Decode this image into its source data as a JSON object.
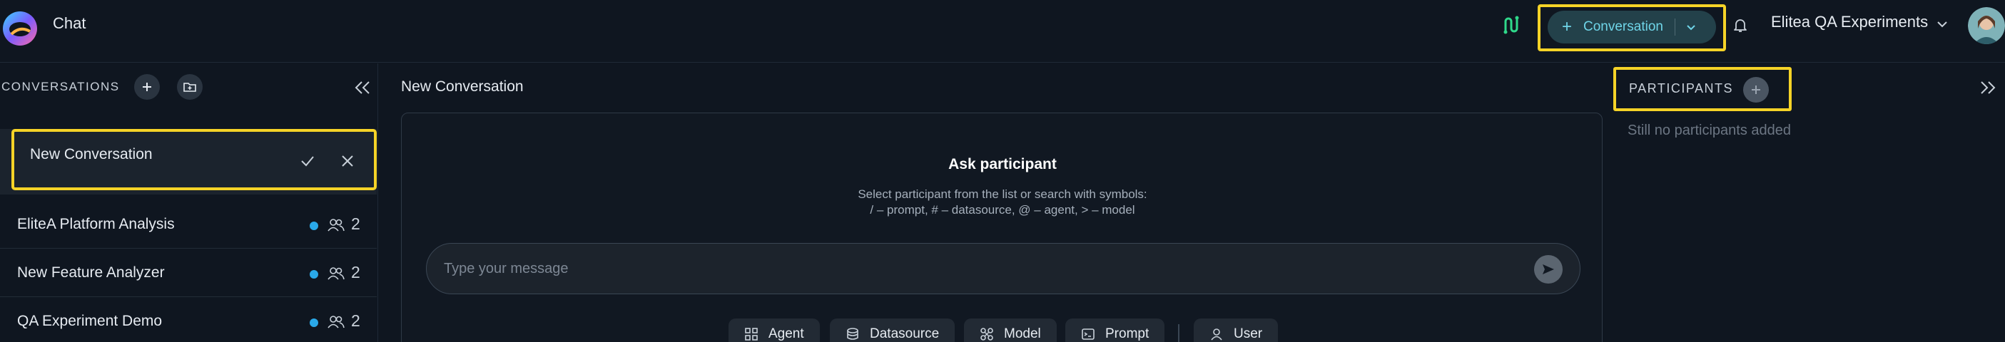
{
  "header": {
    "app_title": "Chat",
    "new_conversation_label": "Conversation",
    "workspace_name": "Elitea QA Experiments",
    "icons": [
      "logo",
      "integration-icon",
      "plus-icon",
      "chevron-down-icon",
      "bell-icon",
      "avatar"
    ]
  },
  "sidebar": {
    "section_title": "CONVERSATIONS",
    "editing": {
      "value": "New Conversation"
    },
    "conversations": [
      {
        "name": "EliteA Platform Analysis",
        "participants": "2"
      },
      {
        "name": "New Feature Analyzer",
        "participants": "2"
      },
      {
        "name": "QA Experiment Demo",
        "participants": "2"
      }
    ],
    "icons": [
      "plus-icon",
      "folder-plus-icon",
      "double-chevron-left-icon",
      "check-icon",
      "close-icon",
      "people-icon"
    ]
  },
  "main": {
    "title": "New Conversation",
    "ask_title": "Ask participant",
    "hint_line1": "Select participant from the list or search with symbols:",
    "hint_line2": "/ – prompt, # – datasource, @ – agent, > – model",
    "input_placeholder": "Type your message",
    "chips": {
      "agent": "Agent",
      "datasource": "Datasource",
      "model": "Model",
      "prompt": "Prompt",
      "user": "User"
    }
  },
  "participants": {
    "title": "PARTICIPANTS",
    "empty": "Still no participants added"
  },
  "colors": {
    "background": "#0f1620",
    "highlight": "#f5d327",
    "accent": "#6fd5e8",
    "status_dot": "#2aa9e9"
  }
}
